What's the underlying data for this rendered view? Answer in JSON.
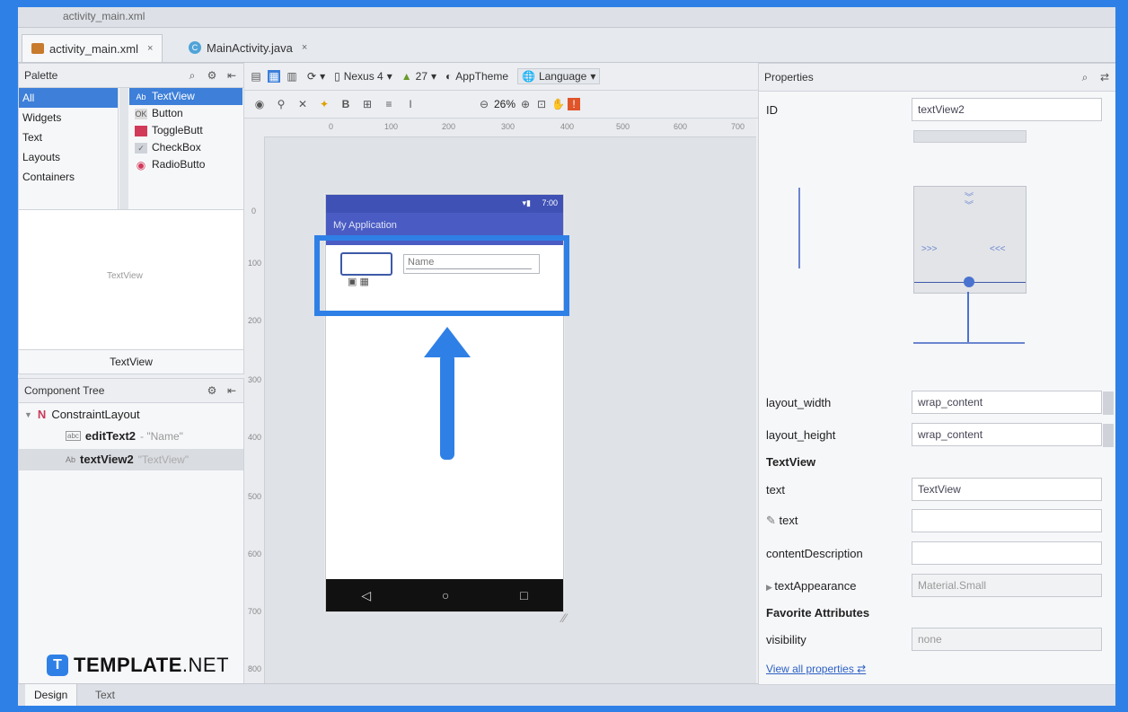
{
  "titlebar": {
    "text": "activity_main.xml"
  },
  "tabs": [
    {
      "label": "activity_main.xml",
      "close": "×",
      "icon": "xml-file-icon"
    },
    {
      "label": "MainActivity.java",
      "close": "×",
      "icon": "java-class-icon",
      "icon_letter": "C"
    }
  ],
  "palette": {
    "title": "Palette",
    "categories": [
      "All",
      "Widgets",
      "Text",
      "Layouts",
      "Containers"
    ],
    "items": [
      {
        "label": "TextView",
        "icon": "Ab"
      },
      {
        "label": "Button",
        "icon": "OK"
      },
      {
        "label": "ToggleButt",
        "icon": ""
      },
      {
        "label": "CheckBox",
        "icon": "✓"
      },
      {
        "label": "RadioButto",
        "icon": "◉"
      }
    ],
    "preview_text": "TextView",
    "preview_caption": "TextView"
  },
  "component_tree": {
    "title": "Component Tree",
    "root": {
      "icon_letter": "N",
      "label": "ConstraintLayout"
    },
    "children": [
      {
        "icon": "abc",
        "label": "editText2",
        "hint": "- \"Name\""
      },
      {
        "icon": "Ab",
        "label": "textView2",
        "hint": "\"TextView\""
      }
    ]
  },
  "toolbar": {
    "device": "Nexus 4",
    "api": "27",
    "theme": "AppTheme",
    "language": "Language",
    "zoom": "26%",
    "bold": "B"
  },
  "ruler_h": [
    "0",
    "100",
    "200",
    "300",
    "400",
    "500",
    "600",
    "700"
  ],
  "ruler_v": [
    "0",
    "100",
    "200",
    "300",
    "400",
    "500",
    "600",
    "700",
    "800"
  ],
  "phone": {
    "status_time": "7:00",
    "app_title": "My Application",
    "edit_text": "Name",
    "nav": [
      "◁",
      "○",
      "□"
    ]
  },
  "properties": {
    "title": "Properties",
    "id_label": "ID",
    "id_value": "textView2",
    "margins": {
      "left": ">>>",
      "right": "<<<"
    },
    "rows": [
      {
        "label": "layout_width",
        "value": "wrap_content",
        "dropdown": true
      },
      {
        "label": "layout_height",
        "value": "wrap_content",
        "dropdown": true
      }
    ],
    "section_textview": "TextView",
    "tv_rows": [
      {
        "label": "text",
        "value": "TextView",
        "gray": false
      },
      {
        "label": "text",
        "value": "",
        "gray": false,
        "tool": true
      },
      {
        "label": "contentDescription",
        "value": "",
        "gray": false
      },
      {
        "label": "textAppearance",
        "value": "Material.Small",
        "gray": true,
        "arrow": true
      }
    ],
    "section_fav": "Favorite Attributes",
    "fav_rows": [
      {
        "label": "visibility",
        "value": "none",
        "gray": true
      }
    ],
    "view_all": "View all properties"
  },
  "bottom_tabs": [
    "Design",
    "Text"
  ],
  "watermark": {
    "brand": "TEMPLATE",
    "suffix": ".NET",
    "logo": "T"
  },
  "colors": {
    "highlight": "#2f80e6",
    "app_bar": "#3f51b5",
    "selection": "#3d7fd9"
  }
}
